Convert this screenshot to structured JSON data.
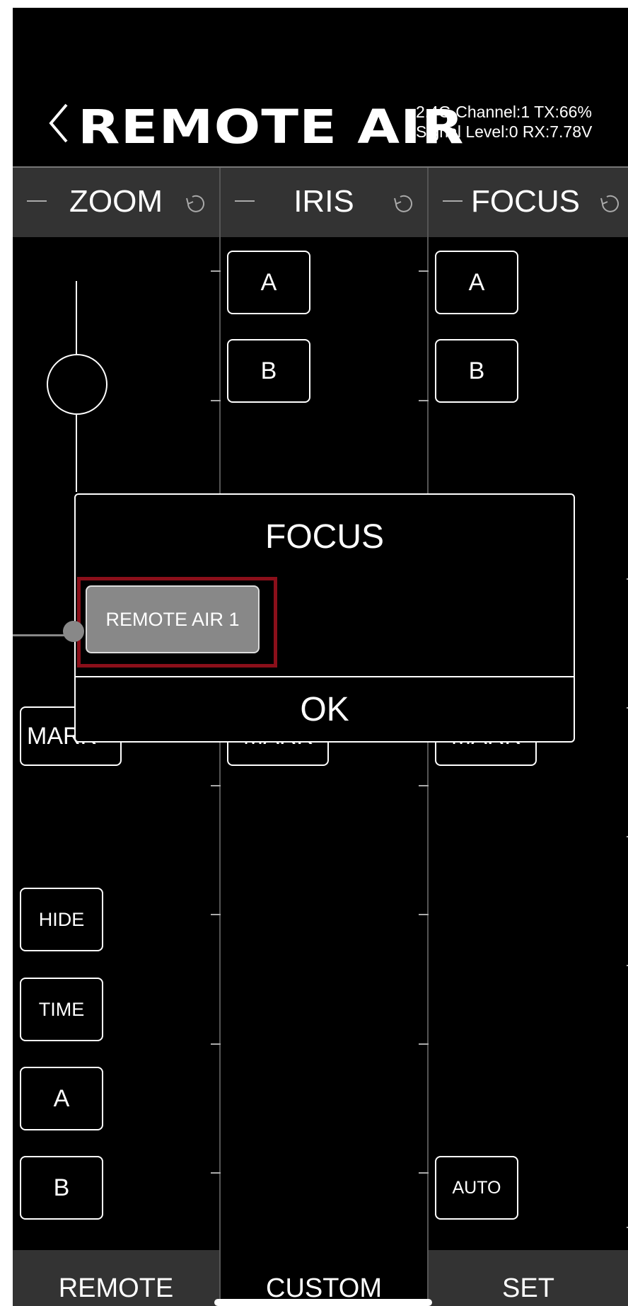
{
  "header": {
    "title": "REMOTE AIR",
    "status_line1": "2.4G Channel:1 TX:66%",
    "status_line2": "Signal Level:0 RX:7.78V"
  },
  "columns": [
    {
      "label": "ZOOM"
    },
    {
      "label": "IRIS"
    },
    {
      "label": "FOCUS"
    }
  ],
  "zoom": {
    "mark_label": "MARK",
    "hide_label": "HIDE",
    "time_label": "TIME",
    "a_label": "A",
    "b_label": "B"
  },
  "iris": {
    "a_label": "A",
    "b_label": "B",
    "mark_label": "MARK"
  },
  "focus": {
    "a_label": "A",
    "b_label": "B",
    "mark_label": "MARK",
    "auto_label": "AUTO"
  },
  "dialog": {
    "title": "FOCUS",
    "device_label": "REMOTE AIR 1",
    "ok_label": "OK"
  },
  "tabs": [
    {
      "label": "REMOTE",
      "active": false
    },
    {
      "label": "CUSTOM",
      "active": true
    },
    {
      "label": "SET",
      "active": false
    }
  ],
  "icons": {
    "back": "chevron-left-icon",
    "reset": "reset-icon"
  }
}
